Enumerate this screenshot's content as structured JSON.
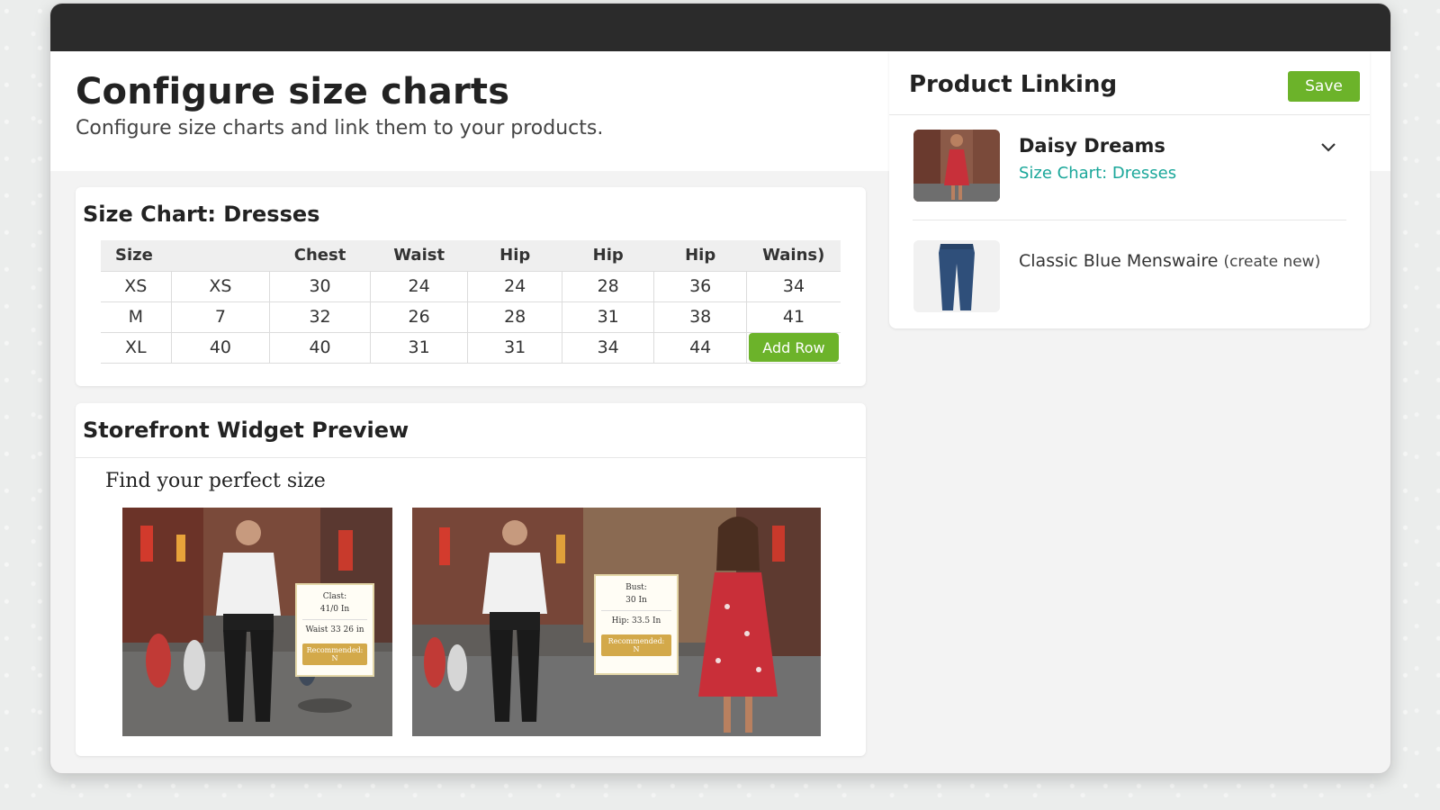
{
  "header": {
    "title": "Configure size charts",
    "subtitle": "Configure size charts and link them to your products."
  },
  "size_chart": {
    "title": "Size Chart: Dresses",
    "columns": [
      "Size",
      "",
      "Chest",
      "Waist",
      "Hip",
      "Hip",
      "Hip",
      "Wains)"
    ],
    "rows": [
      [
        "XS",
        "XS",
        "30",
        "24",
        "24",
        "28",
        "36",
        "34"
      ],
      [
        "M",
        "7",
        "32",
        "26",
        "28",
        "31",
        "38",
        "41"
      ],
      [
        "XL",
        "40",
        "40",
        "31",
        "31",
        "34",
        "44",
        ""
      ]
    ],
    "add_row_label": "Add Row"
  },
  "preview": {
    "title": "Storefront Widget Preview",
    "heading": "Find your perfect size",
    "card1": {
      "line1": "Clast:",
      "line2": "41/0 In",
      "line3": "Waist 33 26 in",
      "button": "Recommended: N"
    },
    "card2": {
      "line1": "Bust:",
      "line2": "30 In",
      "line3": "Hip: 33.5 In",
      "button": "Recommended: N"
    }
  },
  "linking": {
    "title": "Product Linking",
    "save_label": "Save",
    "products": [
      {
        "name": "Daisy Dreams",
        "chart": "Size Chart: Dresses"
      },
      {
        "name": "Classic Blue Menswaire",
        "note": "(create new)"
      }
    ]
  },
  "colors": {
    "accent_green": "#6cb32a",
    "teal_link": "#1aa79a",
    "titlebar": "#2b2b2b"
  }
}
